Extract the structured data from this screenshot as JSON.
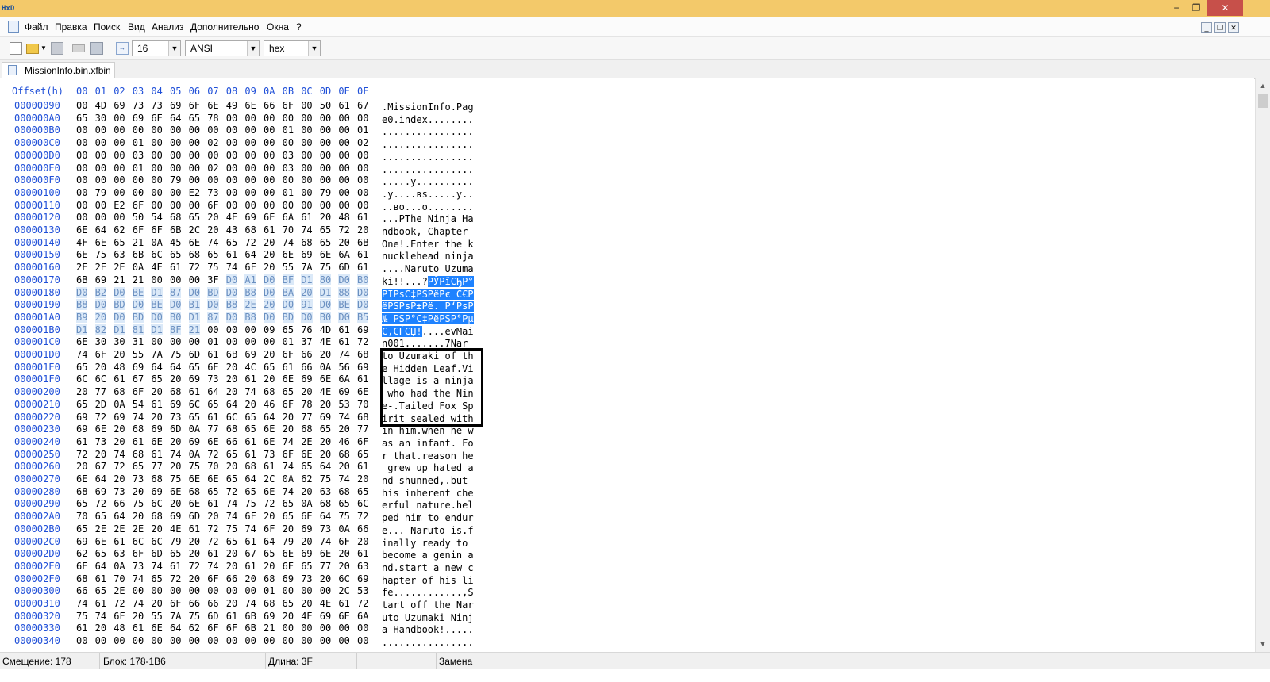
{
  "titlebar": {
    "minimize": "−",
    "restore": "❐",
    "close": "✕"
  },
  "menu": [
    "Файл",
    "Правка",
    "Поиск",
    "Вид",
    "Анализ",
    "Дополнительно",
    "Окна",
    "?"
  ],
  "toolbar": {
    "bytes_per_row": "16",
    "encoding": "ANSI",
    "display": "hex"
  },
  "tab": {
    "label": "MissionInfo.bin.xfbin"
  },
  "editor": {
    "offset_header": "Offset(h)",
    "columns": [
      "00",
      "01",
      "02",
      "03",
      "04",
      "05",
      "06",
      "07",
      "08",
      "09",
      "0A",
      "0B",
      "0C",
      "0D",
      "0E",
      "0F"
    ],
    "rows": [
      {
        "offset": "00000090",
        "bytes": [
          "00",
          "4D",
          "69",
          "73",
          "73",
          "69",
          "6F",
          "6E",
          "49",
          "6E",
          "66",
          "6F",
          "00",
          "50",
          "61",
          "67"
        ],
        "text": ".MissionInfo.Pag"
      },
      {
        "offset": "000000A0",
        "bytes": [
          "65",
          "30",
          "00",
          "69",
          "6E",
          "64",
          "65",
          "78",
          "00",
          "00",
          "00",
          "00",
          "00",
          "00",
          "00",
          "00"
        ],
        "text": "e0.index........"
      },
      {
        "offset": "000000B0",
        "bytes": [
          "00",
          "00",
          "00",
          "00",
          "00",
          "00",
          "00",
          "00",
          "00",
          "00",
          "00",
          "01",
          "00",
          "00",
          "00",
          "01"
        ],
        "text": "................"
      },
      {
        "offset": "000000C0",
        "bytes": [
          "00",
          "00",
          "00",
          "01",
          "00",
          "00",
          "00",
          "02",
          "00",
          "00",
          "00",
          "00",
          "00",
          "00",
          "00",
          "02"
        ],
        "text": "................"
      },
      {
        "offset": "000000D0",
        "bytes": [
          "00",
          "00",
          "00",
          "03",
          "00",
          "00",
          "00",
          "00",
          "00",
          "00",
          "00",
          "03",
          "00",
          "00",
          "00",
          "00"
        ],
        "text": "................"
      },
      {
        "offset": "000000E0",
        "bytes": [
          "00",
          "00",
          "00",
          "01",
          "00",
          "00",
          "00",
          "02",
          "00",
          "00",
          "00",
          "03",
          "00",
          "00",
          "00",
          "00"
        ],
        "text": "................"
      },
      {
        "offset": "000000F0",
        "bytes": [
          "00",
          "00",
          "00",
          "00",
          "00",
          "79",
          "00",
          "00",
          "00",
          "00",
          "00",
          "00",
          "00",
          "00",
          "00",
          "00"
        ],
        "text": ".....y.........."
      },
      {
        "offset": "00000100",
        "bytes": [
          "00",
          "79",
          "00",
          "00",
          "00",
          "00",
          "E2",
          "73",
          "00",
          "00",
          "00",
          "01",
          "00",
          "79",
          "00",
          "00"
        ],
        "text": ".y....вs.....y.."
      },
      {
        "offset": "00000110",
        "bytes": [
          "00",
          "00",
          "E2",
          "6F",
          "00",
          "00",
          "00",
          "6F",
          "00",
          "00",
          "00",
          "00",
          "00",
          "00",
          "00",
          "00"
        ],
        "text": "..вo...o........"
      },
      {
        "offset": "00000120",
        "bytes": [
          "00",
          "00",
          "00",
          "50",
          "54",
          "68",
          "65",
          "20",
          "4E",
          "69",
          "6E",
          "6A",
          "61",
          "20",
          "48",
          "61"
        ],
        "text": "...PThe Ninja Ha"
      },
      {
        "offset": "00000130",
        "bytes": [
          "6E",
          "64",
          "62",
          "6F",
          "6F",
          "6B",
          "2C",
          "20",
          "43",
          "68",
          "61",
          "70",
          "74",
          "65",
          "72",
          "20"
        ],
        "text": "ndbook, Chapter "
      },
      {
        "offset": "00000140",
        "bytes": [
          "4F",
          "6E",
          "65",
          "21",
          "0A",
          "45",
          "6E",
          "74",
          "65",
          "72",
          "20",
          "74",
          "68",
          "65",
          "20",
          "6B"
        ],
        "text": "One!.Enter the k"
      },
      {
        "offset": "00000150",
        "bytes": [
          "6E",
          "75",
          "63",
          "6B",
          "6C",
          "65",
          "68",
          "65",
          "61",
          "64",
          "20",
          "6E",
          "69",
          "6E",
          "6A",
          "61"
        ],
        "text": "nucklehead ninja"
      },
      {
        "offset": "00000160",
        "bytes": [
          "2E",
          "2E",
          "2E",
          "0A",
          "4E",
          "61",
          "72",
          "75",
          "74",
          "6F",
          "20",
          "55",
          "7A",
          "75",
          "6D",
          "61"
        ],
        "text": "....Naruto Uzuma"
      },
      {
        "offset": "00000170",
        "bytes": [
          "6B",
          "69",
          "21",
          "21",
          "00",
          "00",
          "00",
          "3F",
          "D0",
          "A1",
          "D0",
          "BF",
          "D1",
          "80",
          "D0",
          "B0"
        ],
        "text": "ki!!...?РЎРїСЂР°",
        "sel_start": 8
      },
      {
        "offset": "00000180",
        "bytes": [
          "D0",
          "B2",
          "D0",
          "BE",
          "D1",
          "87",
          "D0",
          "BD",
          "D0",
          "B8",
          "D0",
          "BA",
          "20",
          "D1",
          "88",
          "D0"
        ],
        "text": "РІРѕС‡РЅРёРє С€Р",
        "sel_start": 0
      },
      {
        "offset": "00000190",
        "bytes": [
          "B8",
          "D0",
          "BD",
          "D0",
          "BE",
          "D0",
          "B1",
          "D0",
          "B8",
          "2E",
          "20",
          "D0",
          "91",
          "D0",
          "BE",
          "D0"
        ],
        "text": "ёРЅРѕР±Рё. Р‘РѕР",
        "sel_start": 0
      },
      {
        "offset": "000001A0",
        "bytes": [
          "B9",
          "20",
          "D0",
          "BD",
          "D0",
          "B0",
          "D1",
          "87",
          "D0",
          "B8",
          "D0",
          "BD",
          "D0",
          "B0",
          "D0",
          "B5"
        ],
        "text": "№ РЅР°С‡РёРЅР°Рµ",
        "sel_start": 0
      },
      {
        "offset": "000001B0",
        "bytes": [
          "D1",
          "82",
          "D1",
          "81",
          "D1",
          "8F",
          "21",
          "00",
          "00",
          "00",
          "09",
          "65",
          "76",
          "4D",
          "61",
          "69"
        ],
        "text": "С‚СЃСЏ!....evMai",
        "sel_start": 0,
        "sel_end": 6,
        "text_sel_len": 7
      },
      {
        "offset": "000001C0",
        "bytes": [
          "6E",
          "30",
          "30",
          "31",
          "00",
          "00",
          "00",
          "01",
          "00",
          "00",
          "00",
          "01",
          "37",
          "4E",
          "61",
          "72"
        ],
        "text": "n001.......7Nar"
      },
      {
        "offset": "000001D0",
        "bytes": [
          "74",
          "6F",
          "20",
          "55",
          "7A",
          "75",
          "6D",
          "61",
          "6B",
          "69",
          "20",
          "6F",
          "66",
          "20",
          "74",
          "68"
        ],
        "text": "to Uzumaki of th"
      },
      {
        "offset": "000001E0",
        "bytes": [
          "65",
          "20",
          "48",
          "69",
          "64",
          "64",
          "65",
          "6E",
          "20",
          "4C",
          "65",
          "61",
          "66",
          "0A",
          "56",
          "69"
        ],
        "text": "e Hidden Leaf.Vi"
      },
      {
        "offset": "000001F0",
        "bytes": [
          "6C",
          "6C",
          "61",
          "67",
          "65",
          "20",
          "69",
          "73",
          "20",
          "61",
          "20",
          "6E",
          "69",
          "6E",
          "6A",
          "61"
        ],
        "text": "llage is a ninja"
      },
      {
        "offset": "00000200",
        "bytes": [
          "20",
          "77",
          "68",
          "6F",
          "20",
          "68",
          "61",
          "64",
          "20",
          "74",
          "68",
          "65",
          "20",
          "4E",
          "69",
          "6E"
        ],
        "text": " who had the Nin"
      },
      {
        "offset": "00000210",
        "bytes": [
          "65",
          "2D",
          "0A",
          "54",
          "61",
          "69",
          "6C",
          "65",
          "64",
          "20",
          "46",
          "6F",
          "78",
          "20",
          "53",
          "70"
        ],
        "text": "e-.Tailed Fox Sp"
      },
      {
        "offset": "00000220",
        "bytes": [
          "69",
          "72",
          "69",
          "74",
          "20",
          "73",
          "65",
          "61",
          "6C",
          "65",
          "64",
          "20",
          "77",
          "69",
          "74",
          "68"
        ],
        "text": "irit sealed with"
      },
      {
        "offset": "00000230",
        "bytes": [
          "69",
          "6E",
          "20",
          "68",
          "69",
          "6D",
          "0A",
          "77",
          "68",
          "65",
          "6E",
          "20",
          "68",
          "65",
          "20",
          "77"
        ],
        "text": "in him.when he w"
      },
      {
        "offset": "00000240",
        "bytes": [
          "61",
          "73",
          "20",
          "61",
          "6E",
          "20",
          "69",
          "6E",
          "66",
          "61",
          "6E",
          "74",
          "2E",
          "20",
          "46",
          "6F"
        ],
        "text": "as an infant. Fo"
      },
      {
        "offset": "00000250",
        "bytes": [
          "72",
          "20",
          "74",
          "68",
          "61",
          "74",
          "0A",
          "72",
          "65",
          "61",
          "73",
          "6F",
          "6E",
          "20",
          "68",
          "65"
        ],
        "text": "r that.reason he"
      },
      {
        "offset": "00000260",
        "bytes": [
          "20",
          "67",
          "72",
          "65",
          "77",
          "20",
          "75",
          "70",
          "20",
          "68",
          "61",
          "74",
          "65",
          "64",
          "20",
          "61"
        ],
        "text": " grew up hated a"
      },
      {
        "offset": "00000270",
        "bytes": [
          "6E",
          "64",
          "20",
          "73",
          "68",
          "75",
          "6E",
          "6E",
          "65",
          "64",
          "2C",
          "0A",
          "62",
          "75",
          "74",
          "20"
        ],
        "text": "nd shunned,.but "
      },
      {
        "offset": "00000280",
        "bytes": [
          "68",
          "69",
          "73",
          "20",
          "69",
          "6E",
          "68",
          "65",
          "72",
          "65",
          "6E",
          "74",
          "20",
          "63",
          "68",
          "65"
        ],
        "text": "his inherent che"
      },
      {
        "offset": "00000290",
        "bytes": [
          "65",
          "72",
          "66",
          "75",
          "6C",
          "20",
          "6E",
          "61",
          "74",
          "75",
          "72",
          "65",
          "0A",
          "68",
          "65",
          "6C"
        ],
        "text": "erful nature.hel"
      },
      {
        "offset": "000002A0",
        "bytes": [
          "70",
          "65",
          "64",
          "20",
          "68",
          "69",
          "6D",
          "20",
          "74",
          "6F",
          "20",
          "65",
          "6E",
          "64",
          "75",
          "72"
        ],
        "text": "ped him to endur"
      },
      {
        "offset": "000002B0",
        "bytes": [
          "65",
          "2E",
          "2E",
          "2E",
          "20",
          "4E",
          "61",
          "72",
          "75",
          "74",
          "6F",
          "20",
          "69",
          "73",
          "0A",
          "66"
        ],
        "text": "e... Naruto is.f"
      },
      {
        "offset": "000002C0",
        "bytes": [
          "69",
          "6E",
          "61",
          "6C",
          "6C",
          "79",
          "20",
          "72",
          "65",
          "61",
          "64",
          "79",
          "20",
          "74",
          "6F",
          "20"
        ],
        "text": "inally ready to "
      },
      {
        "offset": "000002D0",
        "bytes": [
          "62",
          "65",
          "63",
          "6F",
          "6D",
          "65",
          "20",
          "61",
          "20",
          "67",
          "65",
          "6E",
          "69",
          "6E",
          "20",
          "61"
        ],
        "text": "become a genin a"
      },
      {
        "offset": "000002E0",
        "bytes": [
          "6E",
          "64",
          "0A",
          "73",
          "74",
          "61",
          "72",
          "74",
          "20",
          "61",
          "20",
          "6E",
          "65",
          "77",
          "20",
          "63"
        ],
        "text": "nd.start a new c"
      },
      {
        "offset": "000002F0",
        "bytes": [
          "68",
          "61",
          "70",
          "74",
          "65",
          "72",
          "20",
          "6F",
          "66",
          "20",
          "68",
          "69",
          "73",
          "20",
          "6C",
          "69"
        ],
        "text": "hapter of his li"
      },
      {
        "offset": "00000300",
        "bytes": [
          "66",
          "65",
          "2E",
          "00",
          "00",
          "00",
          "00",
          "00",
          "00",
          "00",
          "01",
          "00",
          "00",
          "00",
          "2C",
          "53"
        ],
        "text": "fe............,S"
      },
      {
        "offset": "00000310",
        "bytes": [
          "74",
          "61",
          "72",
          "74",
          "20",
          "6F",
          "66",
          "66",
          "20",
          "74",
          "68",
          "65",
          "20",
          "4E",
          "61",
          "72"
        ],
        "text": "tart off the Nar"
      },
      {
        "offset": "00000320",
        "bytes": [
          "75",
          "74",
          "6F",
          "20",
          "55",
          "7A",
          "75",
          "6D",
          "61",
          "6B",
          "69",
          "20",
          "4E",
          "69",
          "6E",
          "6A"
        ],
        "text": "uto Uzumaki Ninj"
      },
      {
        "offset": "00000330",
        "bytes": [
          "61",
          "20",
          "48",
          "61",
          "6E",
          "64",
          "62",
          "6F",
          "6F",
          "6B",
          "21",
          "00",
          "00",
          "00",
          "00",
          "00"
        ],
        "text": "a Handbook!....."
      },
      {
        "offset": "00000340",
        "bytes": [
          "00",
          "00",
          "00",
          "00",
          "00",
          "00",
          "00",
          "00",
          "00",
          "00",
          "00",
          "00",
          "00",
          "00",
          "00",
          "00"
        ],
        "text": "................"
      }
    ]
  },
  "status": {
    "offset": "Смещение: 178",
    "block": "Блок: 178-1B6",
    "length": "Длина: 3F",
    "mode": "Замена"
  }
}
